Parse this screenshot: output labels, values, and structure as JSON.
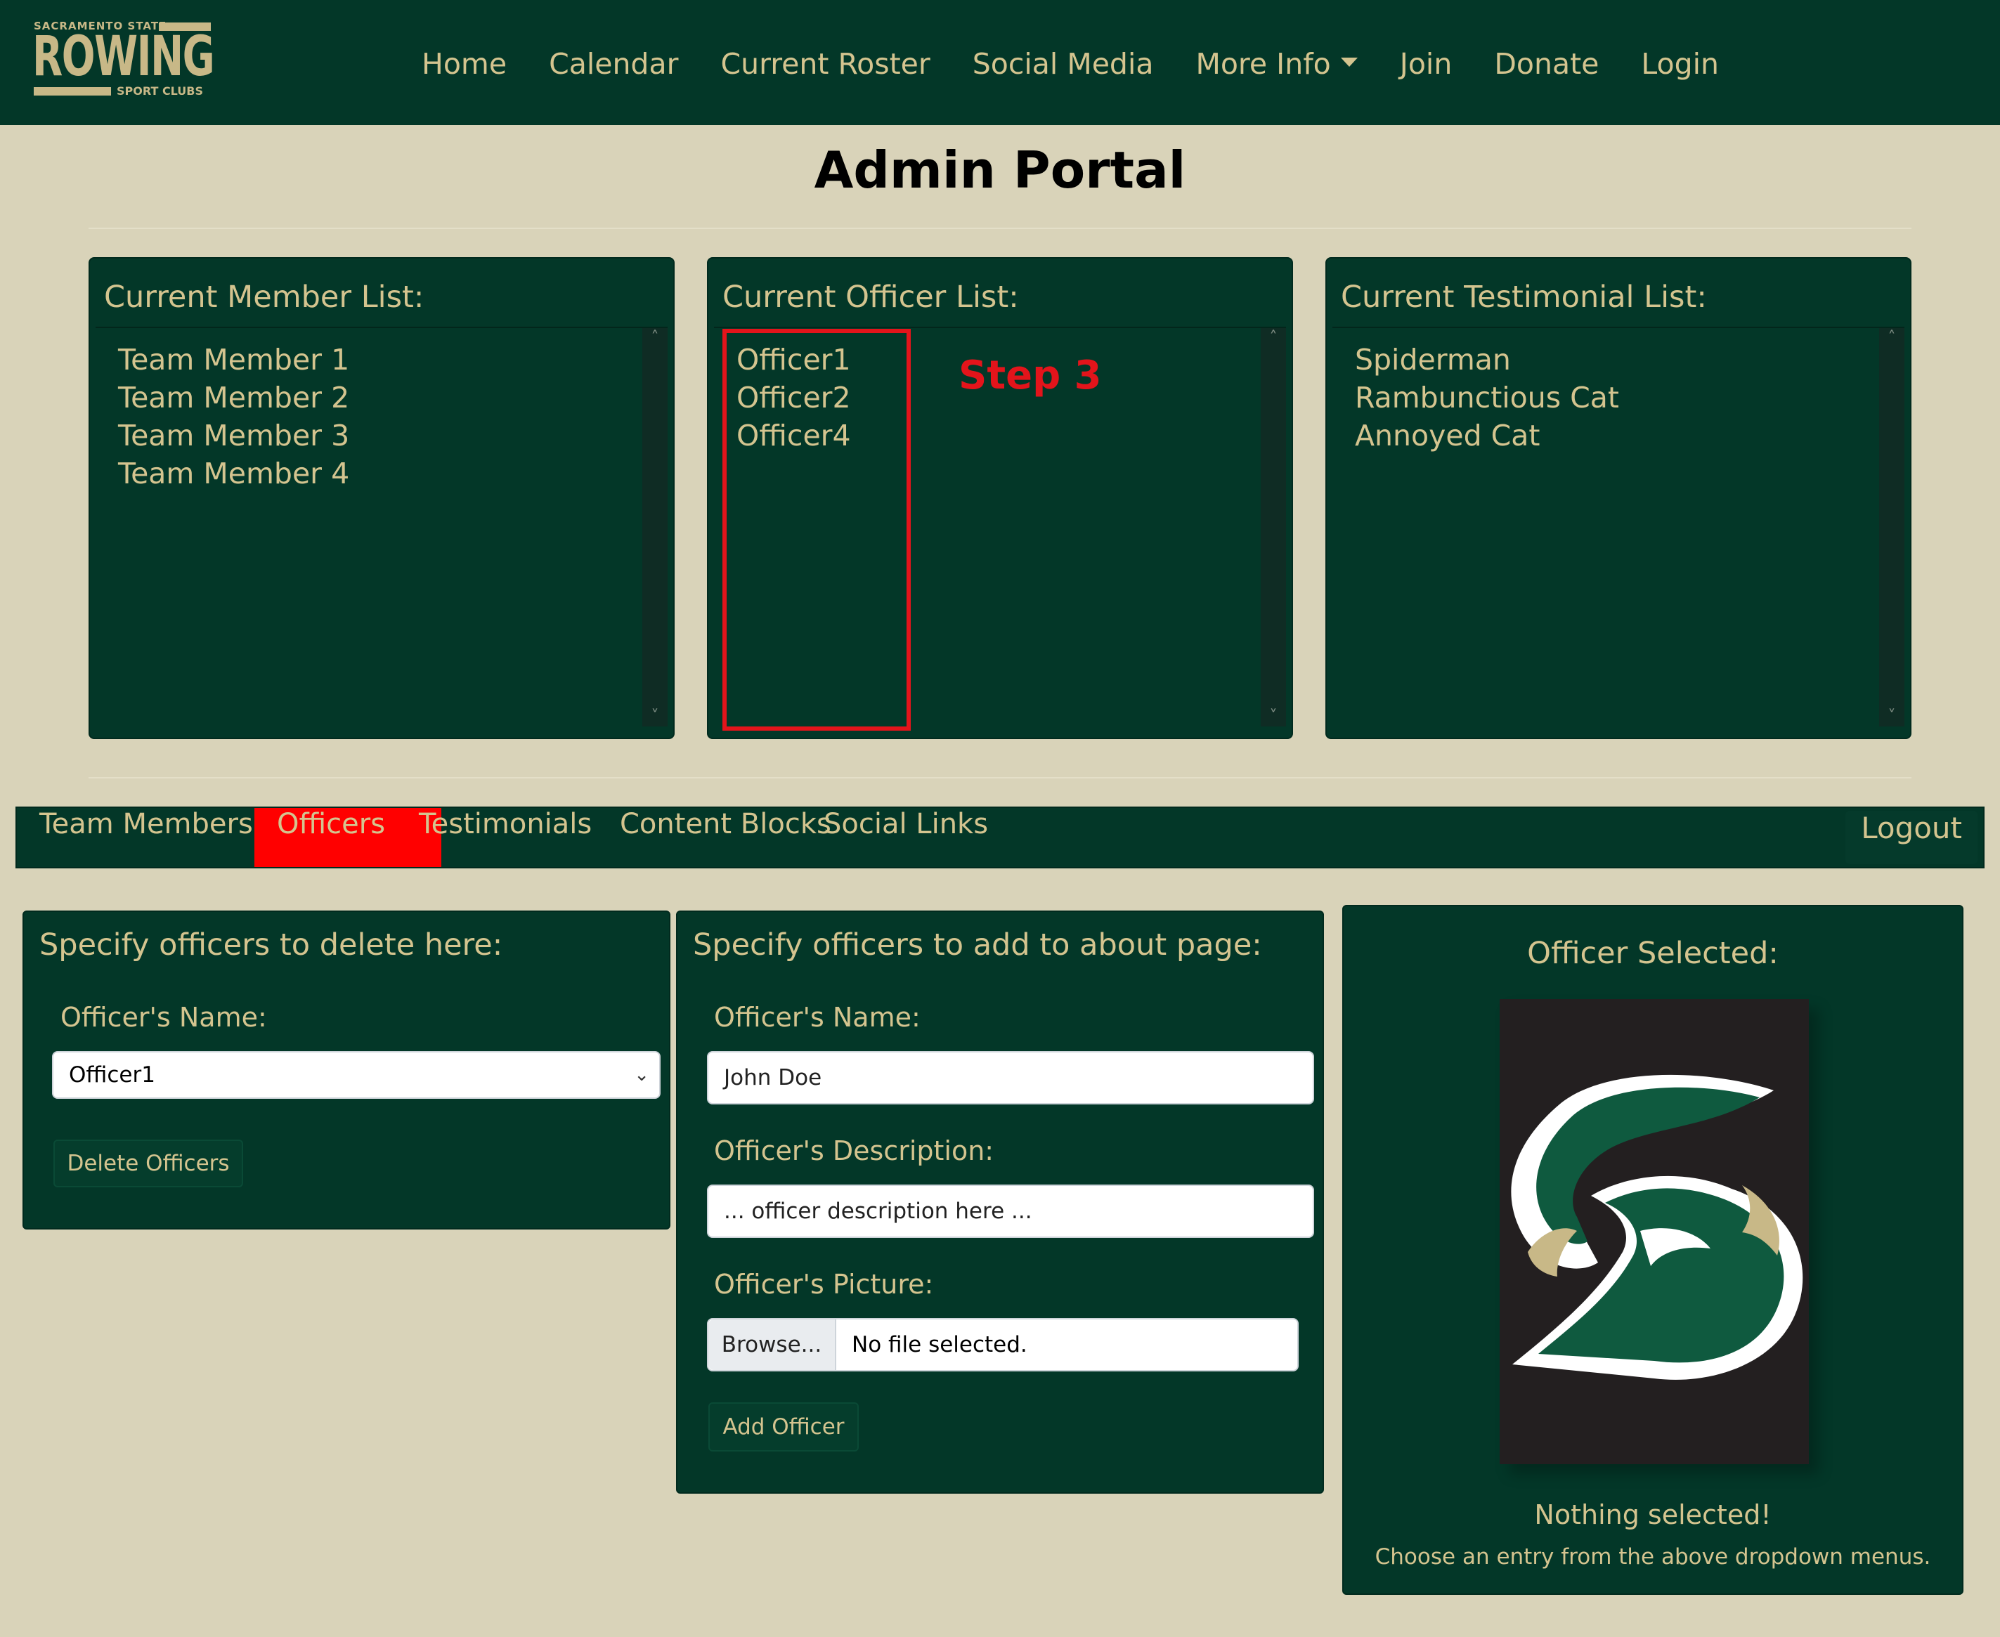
{
  "header": {
    "logo": {
      "top": "SACRAMENTO STATE",
      "word": "ROWING",
      "bottom": "SPORT CLUBS"
    },
    "nav": [
      {
        "label": "Home"
      },
      {
        "label": "Calendar"
      },
      {
        "label": "Current Roster"
      },
      {
        "label": "Social Media"
      },
      {
        "label": "More Info"
      },
      {
        "label": "Join"
      },
      {
        "label": "Donate"
      },
      {
        "label": "Login"
      }
    ]
  },
  "page_title": "Admin Portal",
  "lists": {
    "members": {
      "heading": "Current Member List:",
      "items": [
        "Team Member 1",
        "Team Member 2",
        "Team Member 3",
        "Team Member 4"
      ]
    },
    "officers": {
      "heading": "Current Officer List:",
      "items": [
        "Officer1",
        "Officer2",
        "Officer4"
      ]
    },
    "testimonials": {
      "heading": "Current Testimonial List:",
      "items": [
        "Spiderman",
        "Rambunctious Cat",
        "Annoyed Cat"
      ]
    }
  },
  "annotation": {
    "label": "Step 3",
    "color": "#e3141b"
  },
  "tabs": [
    {
      "label": "Team Members",
      "active": false
    },
    {
      "label": "Officers",
      "active": true
    },
    {
      "label": "Testimonials",
      "active": false
    },
    {
      "label": "Content Blocks",
      "active": false
    },
    {
      "label": "Social Links",
      "active": false
    }
  ],
  "logout_label": "Logout",
  "delete_card": {
    "title": "Specify officers to delete here:",
    "name_label": "Officer's Name:",
    "selected": "Officer1",
    "button": "Delete Officers"
  },
  "add_card": {
    "title": "Specify officers to add to about page:",
    "name_label": "Officer's Name:",
    "name_placeholder": "John Doe",
    "desc_label": "Officer's Description:",
    "desc_placeholder": "... officer description here ...",
    "pic_label": "Officer's Picture:",
    "browse_label": "Browse...",
    "file_status": "No file selected.",
    "button": "Add Officer"
  },
  "preview_card": {
    "title": "Officer Selected:",
    "status": "Nothing selected!",
    "hint": "Choose an entry from the above dropdown menus."
  },
  "colors": {
    "brand_green": "#033728",
    "gold": "#d4c48f",
    "background": "#d9d3b9",
    "active_tab": "#ff0000"
  }
}
